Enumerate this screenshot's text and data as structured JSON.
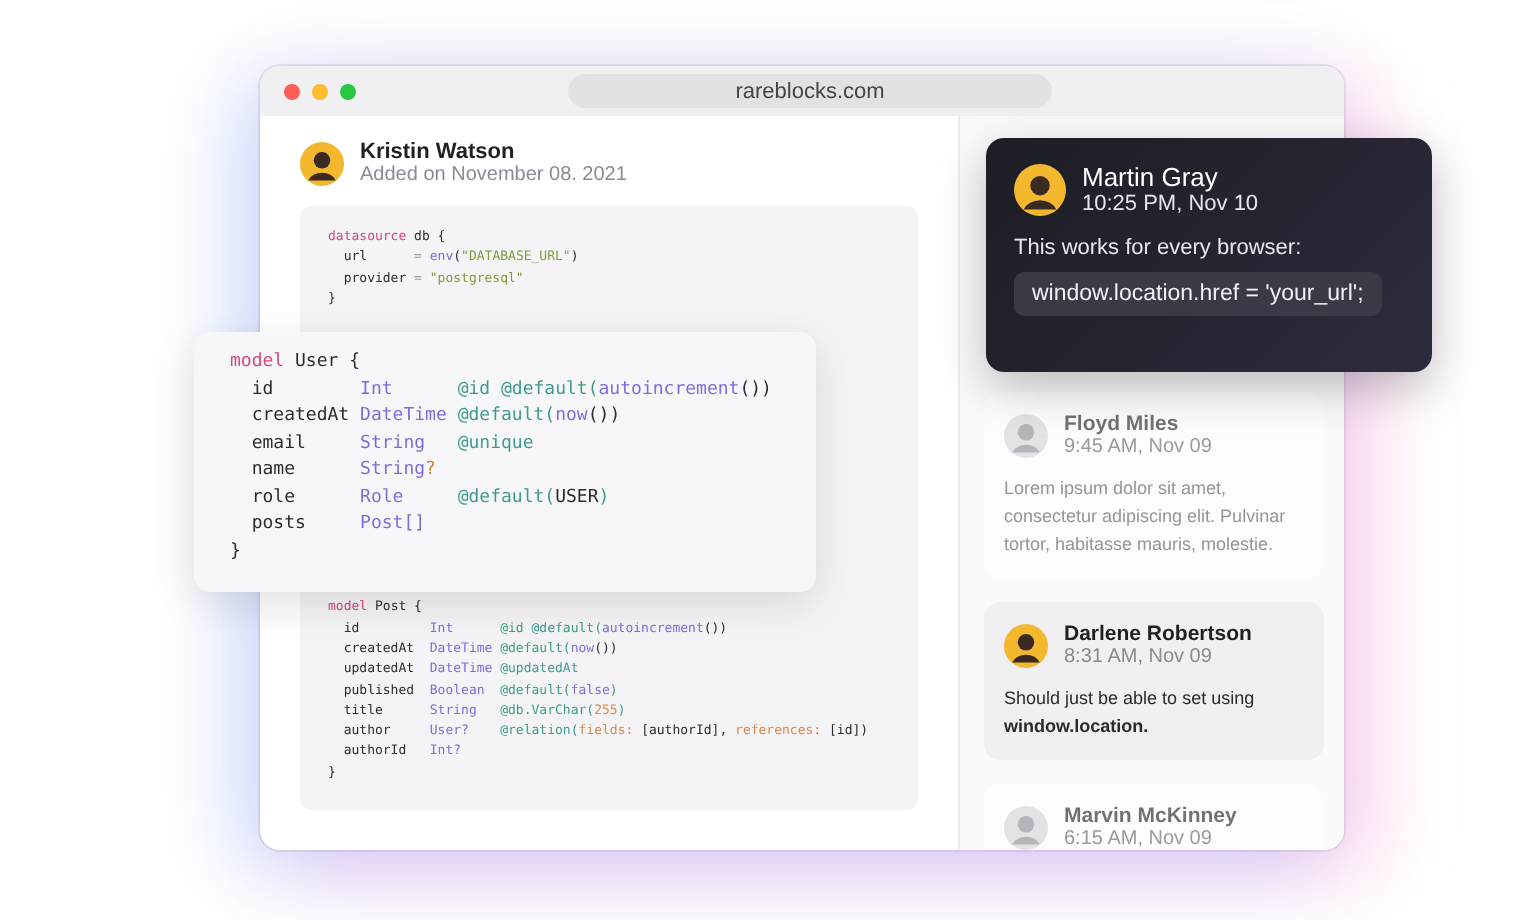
{
  "browser": {
    "address": "rareblocks.com"
  },
  "post": {
    "author": "Kristin Watson",
    "date": "Added on November 08. 2021",
    "code_top": [
      [
        {
          "kind": "keyword",
          "text": "datasource"
        },
        {
          "kind": "plain",
          "text": " db {"
        }
      ],
      [
        {
          "kind": "plain",
          "text": "  url      "
        },
        {
          "kind": "punct",
          "text": "= "
        },
        {
          "kind": "func",
          "text": "env"
        },
        {
          "kind": "plain",
          "text": "("
        },
        {
          "kind": "string",
          "text": "\"DATABASE_URL\""
        },
        {
          "kind": "plain",
          "text": ")"
        }
      ],
      [
        {
          "kind": "plain",
          "text": "  provider "
        },
        {
          "kind": "punct",
          "text": "= "
        },
        {
          "kind": "string",
          "text": "\"postgresql\""
        }
      ],
      [
        {
          "kind": "plain",
          "text": "}"
        }
      ]
    ],
    "code_bottom": [
      [
        {
          "kind": "keyword",
          "text": "model"
        },
        {
          "kind": "plain",
          "text": " Post {"
        }
      ],
      [
        {
          "kind": "plain",
          "text": "  id         "
        },
        {
          "kind": "type",
          "text": "Int      "
        },
        {
          "kind": "attr",
          "text": "@id @default("
        },
        {
          "kind": "func",
          "text": "autoincrement"
        },
        {
          "kind": "plain",
          "text": "())"
        }
      ],
      [
        {
          "kind": "plain",
          "text": "  createdAt  "
        },
        {
          "kind": "type",
          "text": "DateTime "
        },
        {
          "kind": "attr",
          "text": "@default("
        },
        {
          "kind": "func",
          "text": "now"
        },
        {
          "kind": "plain",
          "text": "())"
        }
      ],
      [
        {
          "kind": "plain",
          "text": "  updatedAt  "
        },
        {
          "kind": "type",
          "text": "DateTime "
        },
        {
          "kind": "attr",
          "text": "@updatedAt"
        }
      ],
      [
        {
          "kind": "plain",
          "text": "  published  "
        },
        {
          "kind": "type",
          "text": "Boolean  "
        },
        {
          "kind": "attr",
          "text": "@default("
        },
        {
          "kind": "func",
          "text": "false"
        },
        {
          "kind": "attr",
          "text": ")"
        }
      ],
      [
        {
          "kind": "plain",
          "text": "  title      "
        },
        {
          "kind": "type",
          "text": "String   "
        },
        {
          "kind": "attr",
          "text": "@db.VarChar("
        },
        {
          "kind": "label",
          "text": "255"
        },
        {
          "kind": "attr",
          "text": ")"
        }
      ],
      [
        {
          "kind": "plain",
          "text": "  author     "
        },
        {
          "kind": "type",
          "text": "User?    "
        },
        {
          "kind": "attr",
          "text": "@relation("
        },
        {
          "kind": "label",
          "text": "fields:"
        },
        {
          "kind": "plain",
          "text": " [authorId], "
        },
        {
          "kind": "label",
          "text": "references:"
        },
        {
          "kind": "plain",
          "text": " [id])"
        }
      ],
      [
        {
          "kind": "plain",
          "text": "  authorId   "
        },
        {
          "kind": "type",
          "text": "Int?"
        }
      ],
      [
        {
          "kind": "plain",
          "text": "}"
        }
      ]
    ]
  },
  "floating_code": [
    [
      {
        "kind": "keyword",
        "text": "model"
      },
      {
        "kind": "plain",
        "text": " User {"
      }
    ],
    [
      {
        "kind": "plain",
        "text": "  id        "
      },
      {
        "kind": "type",
        "text": "Int      "
      },
      {
        "kind": "attr",
        "text": "@id @default("
      },
      {
        "kind": "func",
        "text": "autoincrement"
      },
      {
        "kind": "plain",
        "text": "())"
      }
    ],
    [
      {
        "kind": "plain",
        "text": "  createdAt "
      },
      {
        "kind": "type",
        "text": "DateTime "
      },
      {
        "kind": "attr",
        "text": "@default("
      },
      {
        "kind": "func",
        "text": "now"
      },
      {
        "kind": "plain",
        "text": "())"
      }
    ],
    [
      {
        "kind": "plain",
        "text": "  email     "
      },
      {
        "kind": "type",
        "text": "String   "
      },
      {
        "kind": "attr",
        "text": "@unique"
      }
    ],
    [
      {
        "kind": "plain",
        "text": "  name      "
      },
      {
        "kind": "type",
        "text": "String"
      },
      {
        "kind": "opt",
        "text": "?"
      }
    ],
    [
      {
        "kind": "plain",
        "text": "  role      "
      },
      {
        "kind": "type",
        "text": "Role     "
      },
      {
        "kind": "attr",
        "text": "@default("
      },
      {
        "kind": "plain",
        "text": "USER"
      },
      {
        "kind": "attr",
        "text": ")"
      }
    ],
    [
      {
        "kind": "plain",
        "text": "  posts     "
      },
      {
        "kind": "type",
        "text": "Post[]"
      }
    ],
    [
      {
        "kind": "plain",
        "text": "}"
      }
    ]
  ],
  "featured_comment": {
    "author": "Martin Gray",
    "time": "10:25 PM, Nov 10",
    "text": "This works for every browser:",
    "code": "window.location.href = 'your_url';"
  },
  "comments": [
    {
      "author": "Floyd Miles",
      "time": "9:45 AM, Nov 09",
      "text": "Lorem ipsum dolor sit amet, consectetur adipiscing elit. Pulvinar tortor, habitasse mauris, molestie.",
      "faded": true
    },
    {
      "author": "Darlene Robertson",
      "time": "8:31 AM, Nov 09",
      "text": "Should just be able to set using **window.location.**",
      "faded": false
    },
    {
      "author": "Marvin McKinney",
      "time": "6:15 AM, Nov 09",
      "faded": true
    }
  ]
}
